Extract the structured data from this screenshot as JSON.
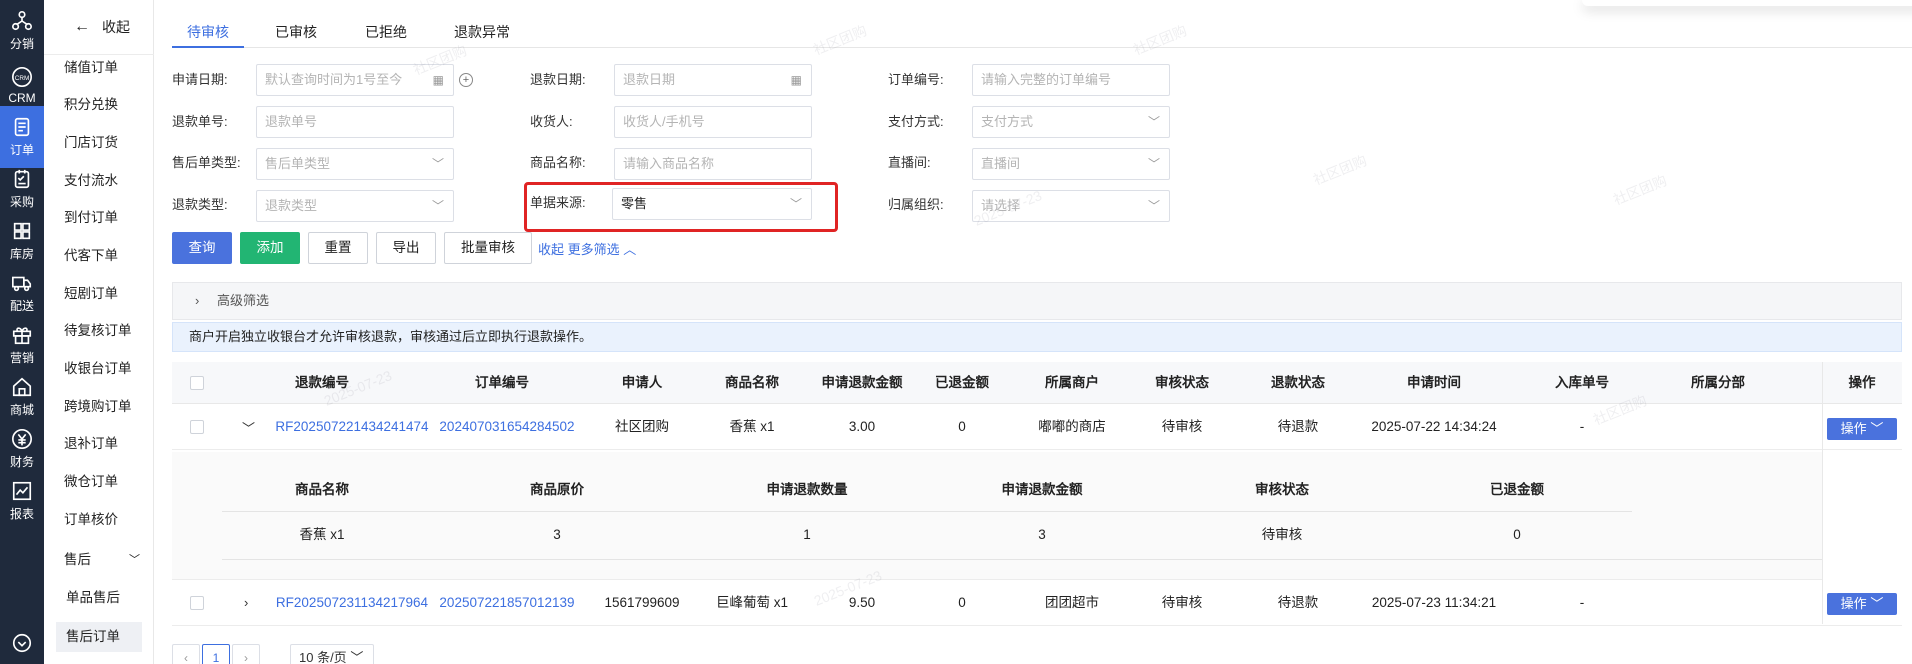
{
  "rail": [
    {
      "label": "分销",
      "icon": "distribution-icon"
    },
    {
      "label": "CRM",
      "icon": "crm-icon"
    },
    {
      "label": "订单",
      "icon": "order-icon",
      "active": true
    },
    {
      "label": "采购",
      "icon": "purchase-icon"
    },
    {
      "label": "库房",
      "icon": "warehouse-icon"
    },
    {
      "label": "配送",
      "icon": "delivery-icon"
    },
    {
      "label": "营销",
      "icon": "marketing-icon"
    },
    {
      "label": "商城",
      "icon": "mall-icon"
    },
    {
      "label": "财务",
      "icon": "finance-icon"
    },
    {
      "label": "报表",
      "icon": "report-icon"
    }
  ],
  "menu": {
    "collapse_label": "收起",
    "items": [
      "储值订单",
      "积分兑换",
      "门店订货",
      "支付流水",
      "到付订单",
      "代客下单",
      "短剧订单",
      "待复核订单",
      "收银台订单",
      "跨境购订单",
      "退补订单",
      "微仓订单",
      "订单核价",
      "售后"
    ],
    "sub_items": [
      "单品售后",
      "售后订单"
    ],
    "selected": "售后订单"
  },
  "tabs": [
    "待审核",
    "已审核",
    "已拒绝",
    "退款异常"
  ],
  "filters": {
    "apply_date": {
      "label": "申请日期:",
      "placeholder": "默认查询时间为1号至今"
    },
    "refund_date": {
      "label": "退款日期:",
      "placeholder": "退款日期"
    },
    "order_no": {
      "label": "订单编号:",
      "placeholder": "请输入完整的订单编号"
    },
    "refund_no": {
      "label": "退款单号:",
      "placeholder": "退款单号"
    },
    "receiver": {
      "label": "收货人:",
      "placeholder": "收货人/手机号"
    },
    "pay_method": {
      "label": "支付方式:",
      "placeholder": "支付方式"
    },
    "aftersale_type": {
      "label": "售后单类型:",
      "placeholder": "售后单类型"
    },
    "product_name": {
      "label": "商品名称:",
      "placeholder": "请输入商品名称"
    },
    "live_room": {
      "label": "直播间:",
      "placeholder": "直播间"
    },
    "refund_type": {
      "label": "退款类型:",
      "placeholder": "退款类型"
    },
    "source": {
      "label": "单据来源:",
      "value": "零售"
    },
    "org": {
      "label": "归属组织:",
      "placeholder": "请选择"
    }
  },
  "buttons": {
    "query": "查询",
    "add": "添加",
    "reset": "重置",
    "export": "导出",
    "batch_review": "批量审核",
    "collapse_link": "收起",
    "more_filter": "更多筛选"
  },
  "advanced_filter": "高级筛选",
  "notice": "商户开启独立收银台才允许审核退款，审核通过后立即执行退款操作。",
  "table": {
    "columns": [
      "退款编号",
      "订单编号",
      "申请人",
      "商品名称",
      "申请退款金额",
      "已退金额",
      "所属商户",
      "审核状态",
      "退款状态",
      "申请时间",
      "入库单号",
      "所属分部",
      "操作"
    ],
    "rows": [
      {
        "refund_no": "RF202507221434241474",
        "order_no": "202407031654284502",
        "applicant": "社区团购",
        "product": "香蕉 x1",
        "apply_amount": "3.00",
        "refunded": "0",
        "merchant": "嘟嘟的商店",
        "review_status": "待审核",
        "refund_status": "待退款",
        "apply_time": "2025-07-22 14:34:24",
        "stock_no": "-",
        "branch": "",
        "op": "操作"
      },
      {
        "refund_no": "RF202507231134217964",
        "order_no": "202507221857012139",
        "applicant": "1561799609",
        "product": "巨峰葡萄 x1",
        "apply_amount": "9.50",
        "refunded": "0",
        "merchant": "团团超市",
        "review_status": "待审核",
        "refund_status": "待退款",
        "apply_time": "2025-07-23 11:34:21",
        "stock_no": "-",
        "branch": "",
        "op": "操作"
      }
    ],
    "sub_columns": [
      "商品名称",
      "商品原价",
      "申请退款数量",
      "申请退款金额",
      "审核状态",
      "已退金额"
    ],
    "sub_row": [
      "香蕉 x1",
      "3",
      "1",
      "3",
      "待审核",
      "0"
    ]
  },
  "pager": {
    "page": "1",
    "size": "10 条/页"
  },
  "watermark": [
    "社区团购",
    "2025-07-23"
  ],
  "colors": {
    "accent": "#3d6fe0",
    "success": "#22b573",
    "rail_bg": "#1f2a3c",
    "highlight": "#e02424"
  }
}
